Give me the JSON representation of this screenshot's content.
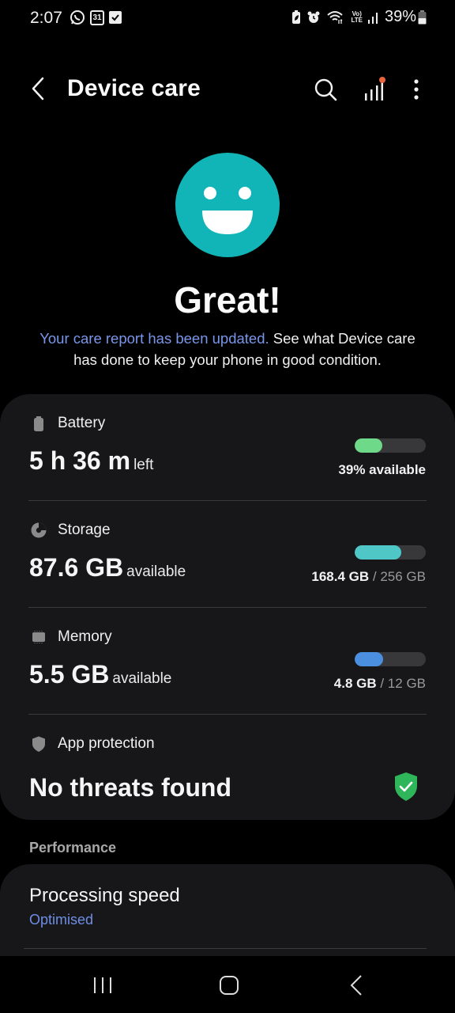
{
  "status_bar": {
    "time": "2:07",
    "left_icons": [
      "whatsapp-icon",
      "calendar-icon",
      "checkbox-icon"
    ],
    "calendar_day": "31",
    "right_icons": [
      "battery-saver-icon",
      "alarm-icon",
      "wifi-icon",
      "volte-icon",
      "signal-icon"
    ],
    "volte_top": "Vo)",
    "volte_bottom": "LTE",
    "battery_percent": "39%"
  },
  "app_bar": {
    "title": "Device care",
    "actions": [
      "search-icon",
      "stats-icon",
      "more-options-icon"
    ],
    "stats_badge_color": "#e8643c"
  },
  "hero": {
    "status_icon": "smiley-face-icon",
    "status_color": "#12b5b7",
    "title": "Great!",
    "link_text": "Your care report has been updated.",
    "description": " See what Device care has done to keep your phone in good condition."
  },
  "items": {
    "battery": {
      "label": "Battery",
      "value": "5 h 36 m",
      "unit": "left",
      "percent": 39,
      "right_text": "39% available",
      "color": "#6fd98a"
    },
    "storage": {
      "label": "Storage",
      "value": "87.6 GB",
      "unit": "available",
      "used": "168.4 GB",
      "total": "/ 256 GB",
      "percent": 66,
      "color": "#4fc7c7"
    },
    "memory": {
      "label": "Memory",
      "value": "5.5 GB",
      "unit": "available",
      "used": "4.8 GB",
      "total": "/ 12 GB",
      "percent": 40,
      "color": "#4a8fe0"
    },
    "protection": {
      "label": "App protection",
      "value": "No threats found",
      "status_color": "#2fb55a"
    }
  },
  "performance": {
    "section_label": "Performance",
    "title": "Processing speed",
    "subtitle": "Optimised"
  },
  "nav_bar": {
    "buttons": [
      "recent-apps",
      "home",
      "back"
    ]
  }
}
